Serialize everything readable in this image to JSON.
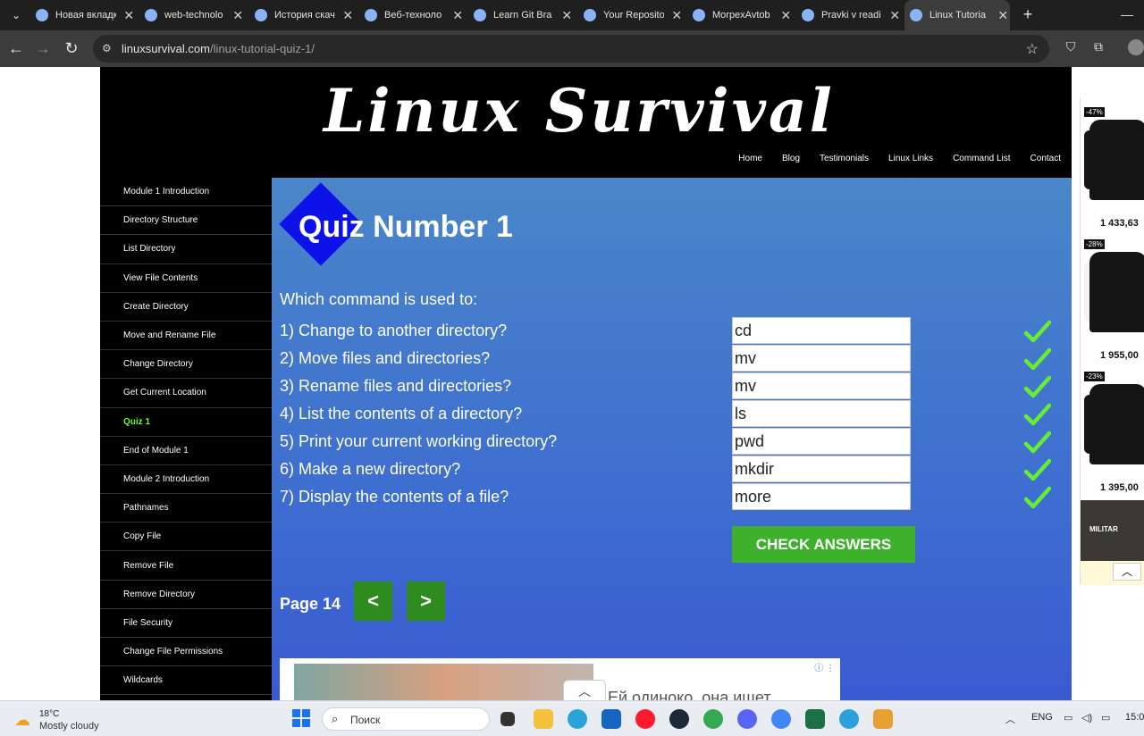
{
  "browser": {
    "tabs": [
      {
        "title": "Новая вкладк"
      },
      {
        "title": "web-technolo"
      },
      {
        "title": "История скач"
      },
      {
        "title": "Веб-техноло"
      },
      {
        "title": "Learn Git Bra"
      },
      {
        "title": "Your Reposito"
      },
      {
        "title": "MorpexAvtob"
      },
      {
        "title": "Pravki v readi"
      },
      {
        "title": "Linux Tutoria"
      }
    ],
    "url_domain": "linuxsurvival.com",
    "url_path": "/linux-tutorial-quiz-1/"
  },
  "site": {
    "logo": "Linux Survival",
    "nav": [
      "Home",
      "Blog",
      "Testimonials",
      "Linux Links",
      "Command List",
      "Contact"
    ],
    "sidebar": [
      "Module 1 Introduction",
      "Directory Structure",
      "List Directory",
      "View File Contents",
      "Create Directory",
      "Move and Rename File",
      "Change Directory",
      "Get Current Location",
      "Quiz 1",
      "End of Module 1",
      "Module 2 Introduction",
      "Pathnames",
      "Copy File",
      "Remove File",
      "Remove Directory",
      "File Security",
      "Change File Permissions",
      "Wildcards"
    ],
    "sidebar_active_index": 8
  },
  "quiz": {
    "title": "Quiz Number 1",
    "intro": "Which command is used to:",
    "questions": [
      {
        "text": "1) Change to another directory?",
        "answer": "cd"
      },
      {
        "text": "2) Move files and directories?",
        "answer": "mv"
      },
      {
        "text": "3) Rename files and directories?",
        "answer": "mv"
      },
      {
        "text": "4) List the contents of a directory?",
        "answer": "ls"
      },
      {
        "text": "5) Print your current working directory?",
        "answer": "pwd"
      },
      {
        "text": "6) Make a new directory?",
        "answer": "mkdir"
      },
      {
        "text": "7) Display the contents of a file?",
        "answer": "more"
      }
    ],
    "check_label": "CHECK ANSWERS",
    "page_label": "Page 14",
    "prev_label": "<",
    "next_label": ">"
  },
  "ad": {
    "text": "Ей одиноко, она ищет"
  },
  "side_ads": [
    {
      "badge": "-47%",
      "price": "1 433,63"
    },
    {
      "badge": "-28%",
      "price": "1 955,00"
    },
    {
      "badge": "-23%",
      "price": "1 395,00"
    }
  ],
  "side_ad_brand": "MILITAR",
  "taskbar": {
    "temp": "18°C",
    "condition": "Mostly cloudy",
    "search_placeholder": "Поиск",
    "lang": "ENG",
    "time": "15:0"
  },
  "colors": {
    "check_green": "#66ee33",
    "button_green": "#3db12b",
    "diamond_blue": "#0d12e8"
  }
}
